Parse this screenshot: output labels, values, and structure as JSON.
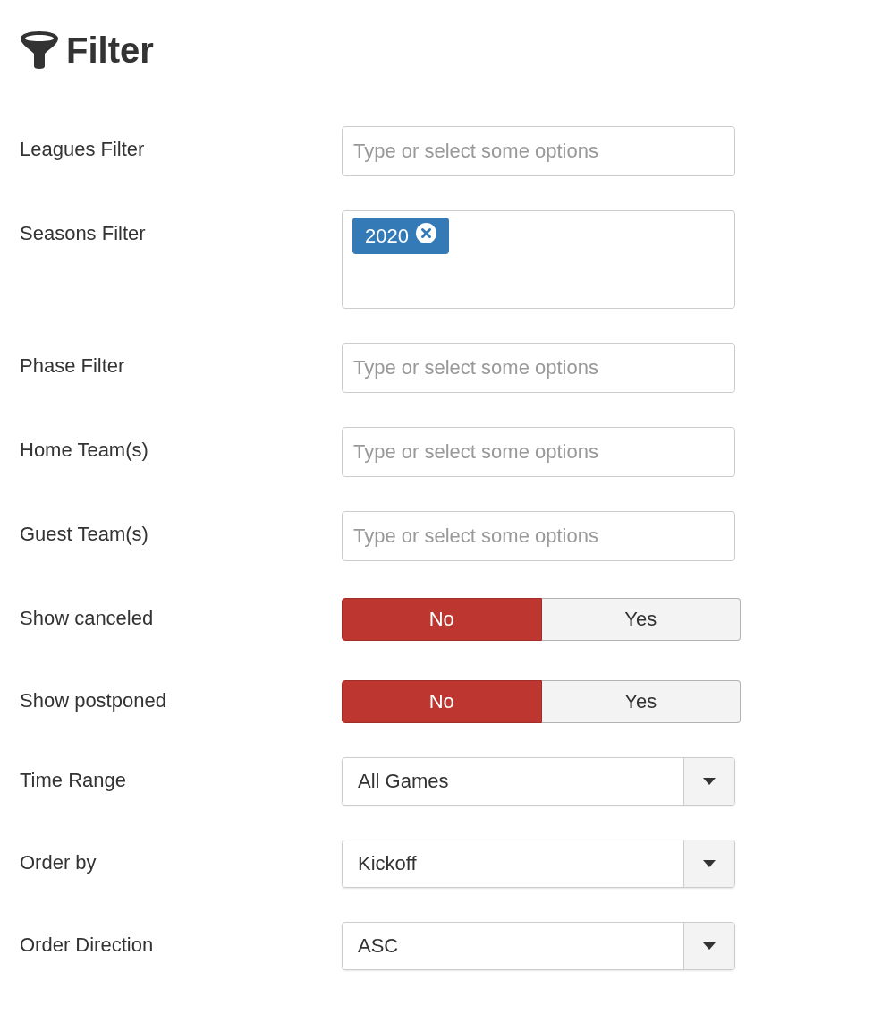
{
  "title": "Filter",
  "fields": [
    {
      "kind": "multiselect",
      "label": "Leagues Filter",
      "placeholder": "Type or select some options"
    },
    {
      "kind": "multiselect",
      "label": "Seasons Filter",
      "tags": [
        "2020"
      ]
    },
    {
      "kind": "multiselect",
      "label": "Phase Filter",
      "placeholder": "Type or select some options"
    },
    {
      "kind": "multiselect",
      "label": "Home Team(s)",
      "placeholder": "Type or select some options"
    },
    {
      "kind": "multiselect",
      "label": "Guest Team(s)",
      "placeholder": "Type or select some options"
    },
    {
      "kind": "toggle",
      "label": "Show canceled",
      "options": [
        {
          "label": "No",
          "selected": true
        },
        {
          "label": "Yes",
          "selected": false
        }
      ]
    },
    {
      "kind": "toggle",
      "label": "Show postponed",
      "options": [
        {
          "label": "No",
          "selected": true
        },
        {
          "label": "Yes",
          "selected": false
        }
      ]
    },
    {
      "kind": "select",
      "label": "Time Range",
      "value": "All Games"
    },
    {
      "kind": "select",
      "label": "Order by",
      "value": "Kickoff"
    },
    {
      "kind": "select",
      "label": "Order Direction",
      "value": "ASC"
    }
  ]
}
